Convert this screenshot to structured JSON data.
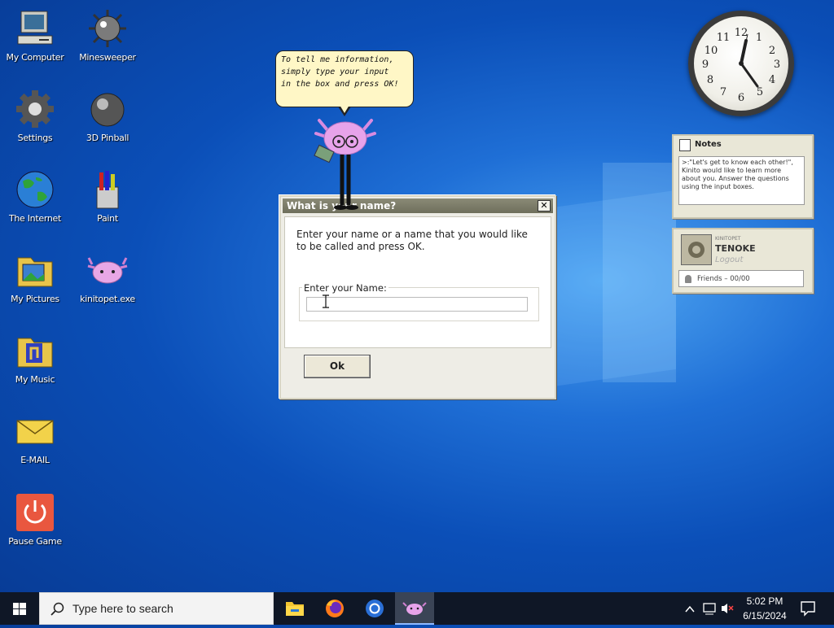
{
  "desktop": {
    "icons": [
      {
        "label": "My Computer"
      },
      {
        "label": "Minesweeper"
      },
      {
        "label": "Settings"
      },
      {
        "label": "3D Pinball"
      },
      {
        "label": "The Internet"
      },
      {
        "label": "Paint"
      },
      {
        "label": "My Pictures"
      },
      {
        "label": "kinitopet.exe"
      },
      {
        "label": "My Music"
      },
      {
        "label": "E-MAIL"
      },
      {
        "label": "Pause Game"
      }
    ]
  },
  "bubble": {
    "text_line1": "To tell me information,",
    "text_line2": "simply type your input",
    "text_line3": "in the box and press OK!"
  },
  "dialog": {
    "title": "What is your name?",
    "close": "✕",
    "message": "Enter your name or a name that you would like to be called and press OK.",
    "field_label": "Enter your Name:",
    "input_value": "",
    "ok_label": "Ok"
  },
  "clock": {
    "numbers": [
      "12",
      "1",
      "2",
      "3",
      "4",
      "5",
      "6",
      "7",
      "8",
      "9",
      "10",
      "11"
    ]
  },
  "notes": {
    "title": "Notes",
    "text": ">:\"Let's get to know each other!\", Kinito would like to learn more about you. Answer the questions using the input boxes."
  },
  "profile": {
    "small": "KINITOPET",
    "name": "TENOKE",
    "logout": "Logout",
    "friends": "Friends – 00/00"
  },
  "taskbar": {
    "search_placeholder": "Type here to search",
    "time": "5:02 PM",
    "date": "6/15/2024"
  },
  "colors": {
    "accent": "#0b4fb8",
    "dialog_title": "#7b7b68",
    "bubble": "#fff7c6"
  }
}
